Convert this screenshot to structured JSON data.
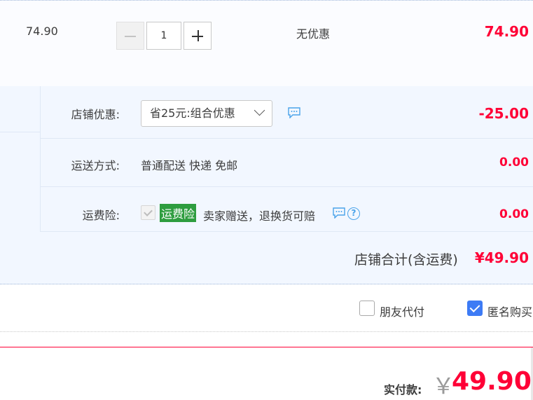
{
  "item": {
    "unit_price": "74.90",
    "quantity": "1",
    "discount_text": "无优惠",
    "subtotal": "74.90"
  },
  "shop": {
    "promo": {
      "label": "店铺优惠:",
      "selected": "省25元:组合优惠",
      "amount": "-25.00"
    },
    "shipping": {
      "label": "运送方式:",
      "method": "普通配送 快递 免邮",
      "amount": "0.00"
    },
    "insurance": {
      "label": "运费险:",
      "badge": "运费险",
      "text": "卖家赠送，退换货可赔",
      "amount": "0.00"
    },
    "total_label": "店铺合计(含运费)",
    "total_value": "¥49.90"
  },
  "options": {
    "friend_pay": {
      "label": "朋友代付",
      "checked": false
    },
    "anonymous": {
      "label": "匿名购买",
      "checked": true
    }
  },
  "payment": {
    "label": "实付款:",
    "currency": "￥",
    "amount": "49.90"
  },
  "colors": {
    "accent_red": "#ff0036",
    "checkbox_blue": "#3d7bf5",
    "badge_green": "#2e9d3f",
    "icon_blue": "#4aa3ea"
  },
  "icons": [
    "minus-icon",
    "plus-icon",
    "chevron-down-icon",
    "message-icon",
    "help-icon",
    "check-icon"
  ]
}
